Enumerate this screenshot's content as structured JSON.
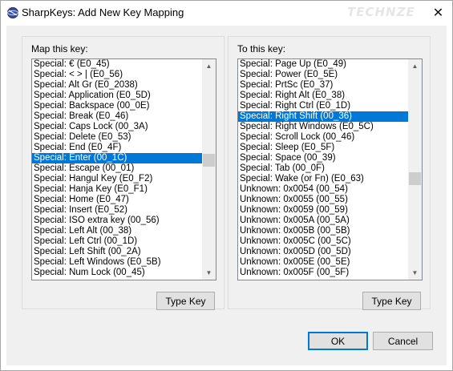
{
  "window": {
    "title": "SharpKeys: Add New Key Mapping",
    "watermark": "TECHNZE",
    "close_glyph": "✕",
    "app_icon": "sharpkeys-app-icon"
  },
  "left_panel": {
    "label": "Map this key:",
    "type_key_label": "Type Key",
    "scroll_fraction": 0.45,
    "items": [
      "Special: € (E0_45)",
      "Special: < > | (E0_56)",
      "Special: Alt Gr (E0_2038)",
      "Special: Application (E0_5D)",
      "Special: Backspace (00_0E)",
      "Special: Break (E0_46)",
      "Special: Caps Lock (00_3A)",
      "Special: Delete (E0_53)",
      "Special: End (E0_4F)",
      "Special: Enter (00_1C)",
      "Special: Escape (00_01)",
      "Special: Hangul Key (E0_F2)",
      "Special: Hanja Key (E0_F1)",
      "Special: Home (E0_47)",
      "Special: Insert (E0_52)",
      "Special: ISO extra key (00_56)",
      "Special: Left Alt (00_38)",
      "Special: Left Ctrl (00_1D)",
      "Special: Left Shift (00_2A)",
      "Special: Left Windows (E0_5B)",
      "Special: Num Lock (00_45)"
    ],
    "selected_index": 9
  },
  "right_panel": {
    "label": "To this key:",
    "type_key_label": "Type Key",
    "scroll_fraction": 0.55,
    "items": [
      "Special: Page Up (E0_49)",
      "Special: Power (E0_5E)",
      "Special: PrtSc (E0_37)",
      "Special: Right Alt (E0_38)",
      "Special: Right Ctrl (E0_1D)",
      "Special: Right Shift (00_36)",
      "Special: Right Windows (E0_5C)",
      "Special: Scroll Lock (00_46)",
      "Special: Sleep (E0_5F)",
      "Special: Space (00_39)",
      "Special: Tab (00_0F)",
      "Special: Wake (or Fn) (E0_63)",
      "Unknown: 0x0054 (00_54)",
      "Unknown: 0x0055 (00_55)",
      "Unknown: 0x0059 (00_59)",
      "Unknown: 0x005A (00_5A)",
      "Unknown: 0x005B (00_5B)",
      "Unknown: 0x005C (00_5C)",
      "Unknown: 0x005D (00_5D)",
      "Unknown: 0x005E (00_5E)",
      "Unknown: 0x005F (00_5F)"
    ],
    "selected_index": 5
  },
  "buttons": {
    "ok": "OK",
    "cancel": "Cancel"
  },
  "scroll_arrows": {
    "up": "▲",
    "down": "▼"
  },
  "colors": {
    "selection": "#0078d7",
    "dialog_bg": "#f0f0f0",
    "button_bg": "#e1e1e1"
  }
}
